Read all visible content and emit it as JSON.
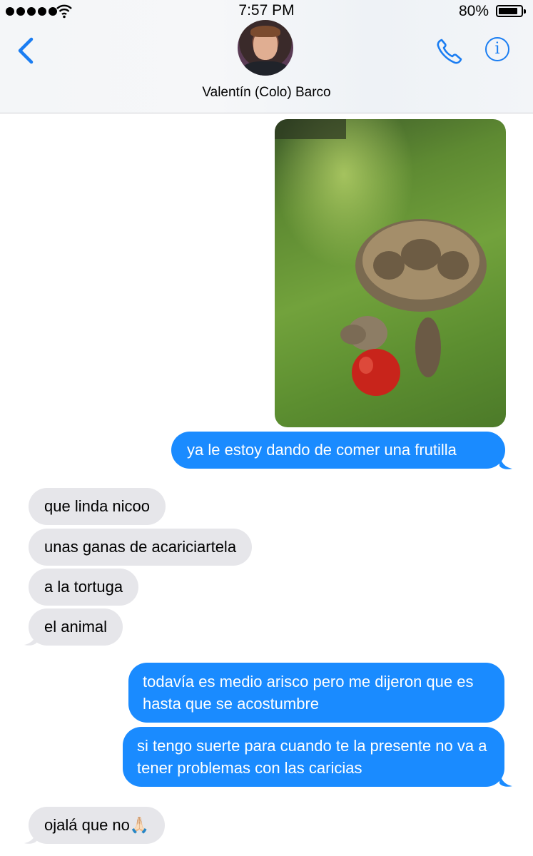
{
  "status_bar": {
    "time": "7:57 PM",
    "battery_percent": "80%"
  },
  "header": {
    "contact_name": "Valentín (Colo) Barco"
  },
  "messages": [
    {
      "type": "image",
      "direction": "outgoing",
      "description": "photo"
    },
    {
      "direction": "outgoing",
      "text": "ya le estoy dando de comer una frutilla"
    },
    {
      "direction": "incoming",
      "text": "que linda nicoo"
    },
    {
      "direction": "incoming",
      "text": "unas ganas de acariciartela"
    },
    {
      "direction": "incoming",
      "text": "a la tortuga"
    },
    {
      "direction": "incoming",
      "text": "el animal"
    },
    {
      "direction": "outgoing",
      "text": "todavía es medio arisco pero me dijeron que es hasta que se acostumbre"
    },
    {
      "direction": "outgoing",
      "text": "si tengo suerte para cuando te la presente no va a tener problemas con las caricias"
    },
    {
      "direction": "incoming",
      "text": "ojalá que no🙏🏻"
    }
  ],
  "colors": {
    "accent": "#1a7df2",
    "outgoing_bubble": "#1a8bff",
    "incoming_bubble": "#e6e6ea"
  }
}
